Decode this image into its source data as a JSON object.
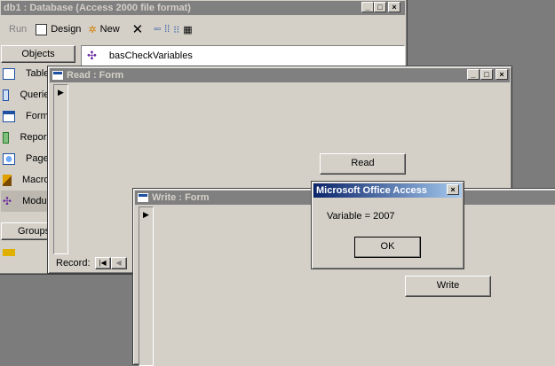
{
  "database_window": {
    "title": "db1 : Database (Access 2000 file format)",
    "toolbar": {
      "run": "Run",
      "design": "Design",
      "new": "New"
    },
    "objects_header": "Objects",
    "module_item": "basCheckVariables",
    "objects": [
      "Tables",
      "Queries",
      "Forms",
      "Reports",
      "Pages",
      "Macros",
      "Modules"
    ],
    "groups_header": "Groups"
  },
  "read_form": {
    "title": "Read : Form",
    "button": "Read",
    "record_label": "Record:"
  },
  "write_form": {
    "title": "Write : Form",
    "button": "Write"
  },
  "message_box": {
    "title": "Microsoft Office Access",
    "message": "Variable = 2007",
    "ok": "OK"
  },
  "colors": {
    "active_title": "#0a246a",
    "inactive_title": "#808080",
    "face": "#d4d0c8"
  },
  "icons": [
    "minimize-icon",
    "maximize-icon",
    "close-icon",
    "delete-icon",
    "form-icon",
    "record-selector-icon",
    "module-icon"
  ]
}
